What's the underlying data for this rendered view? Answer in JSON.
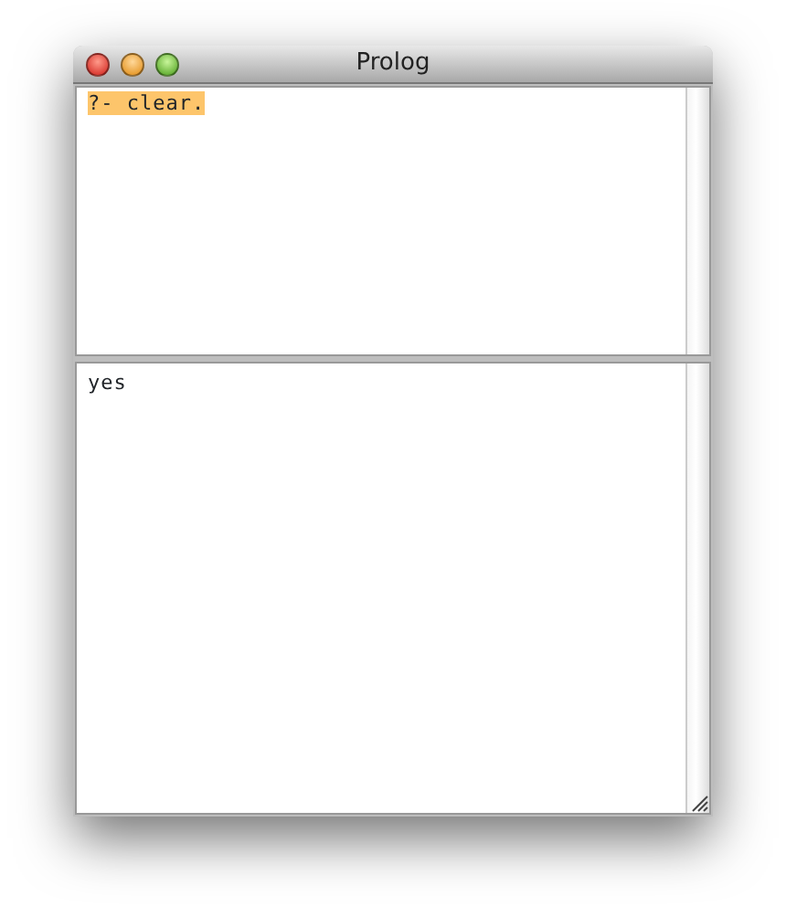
{
  "window": {
    "title": "Prolog"
  },
  "query_pane": {
    "text": "?- clear.",
    "highlighted": true
  },
  "output_pane": {
    "text": "yes"
  }
}
